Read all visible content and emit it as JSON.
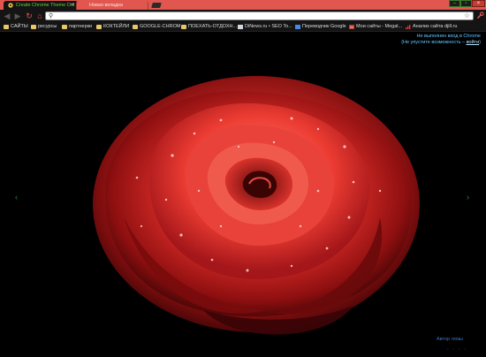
{
  "tabs": [
    {
      "label": "Create Chrome Theme Onl",
      "active": true
    },
    {
      "label": "Новая вкладка",
      "active": false
    }
  ],
  "window_controls": {
    "minimize": "–",
    "maximize": "▫",
    "close": "×"
  },
  "toolbar": {
    "back_icon": "◀",
    "forward_icon": "▶",
    "reload_icon": "↻",
    "home_icon": "⌂",
    "omnibox_value": "",
    "star_icon": "☆",
    "wrench_icon": "🔧"
  },
  "bookmarks": [
    {
      "label": "САЙТЫ",
      "icon": "folder"
    },
    {
      "label": "ресурсы",
      "icon": "folder"
    },
    {
      "label": "партнерки",
      "icon": "folder"
    },
    {
      "label": "КОКТЕЙЛИ",
      "icon": "folder"
    },
    {
      "label": "GOOGLE-CHROM",
      "icon": "folder"
    },
    {
      "label": "ПОЕХАТЬ-ОТДОХН...",
      "icon": "folder"
    },
    {
      "label": "DiNews.ru • SEO To...",
      "icon": "page"
    },
    {
      "label": "Переводчик Google",
      "icon": "translate"
    },
    {
      "label": "Мои сайты - Megal...",
      "icon": "mail"
    },
    {
      "label": "Анализ сайта djill.ru",
      "icon": "chart"
    }
  ],
  "ntp": {
    "signin_line1": "Не выполнен вход в Chrome",
    "signin_line2_prefix": "(Не упустите возможность – ",
    "signin_link": "войти",
    "signin_line2_suffix": ")",
    "author_label": "Автор темы",
    "left_arrow": "‹",
    "right_arrow": "›"
  },
  "colors": {
    "titlebar": "#e1574f",
    "active_tab_text": "#5fd63a",
    "signin_text": "#62c6ff",
    "author_text": "#3a78c8"
  }
}
